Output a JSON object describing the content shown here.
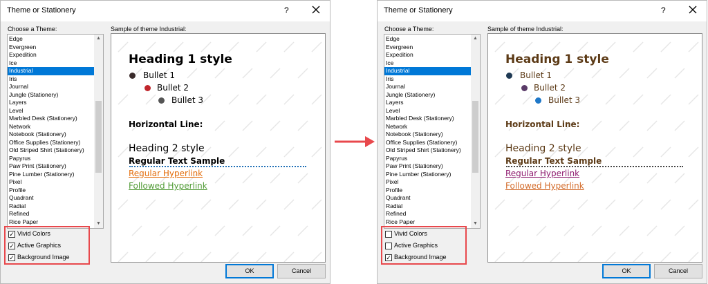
{
  "arrow_color": "#e8484c",
  "dialogs": [
    {
      "title": "Theme or Stationery",
      "help": "?",
      "choose_label": "Choose a Theme:",
      "sample_label": "Sample of theme Industrial:",
      "themes": [
        "Edge",
        "Evergreen",
        "Expedition",
        "Ice",
        "Industrial",
        "Iris",
        "Journal",
        "Jungle (Stationery)",
        "Layers",
        "Level",
        "Marbled Desk (Stationery)",
        "Network",
        "Notebook (Stationery)",
        "Office Supplies (Stationery)",
        "Old Striped Shirt (Stationery)",
        "Papyrus",
        "Paw Print (Stationery)",
        "Pine Lumber (Stationery)",
        "Pixel",
        "Profile",
        "Quadrant",
        "Radial",
        "Refined",
        "Rice Paper"
      ],
      "selected_index": 4,
      "options": [
        {
          "label": "Vivid Colors",
          "checked": true
        },
        {
          "label": "Active Graphics",
          "checked": true
        },
        {
          "label": "Background Image",
          "checked": true
        }
      ],
      "preview": {
        "heading1": "Heading 1 style",
        "bullets": [
          "Bullet 1",
          "Bullet 2",
          "Bullet 3"
        ],
        "horizontal_line": "Horizontal Line:",
        "heading2": "Heading 2 style",
        "regular": "Regular Text Sample",
        "hyperlink": "Regular Hyperlink",
        "followed": "Followed Hyperlink",
        "colors": {
          "heading1": "#000000",
          "bullet_text": "#000000",
          "horizontal_line": "#000000",
          "heading2": "#000000",
          "regular": "#000000",
          "hyperlink": "#e36c0a",
          "followed": "#4f9a34",
          "bullet1": "#3a2b2b",
          "bullet2": "#c0262c",
          "bullet3": "#555555",
          "rule": "#1f6fb6"
        }
      },
      "ok": "OK",
      "cancel": "Cancel"
    },
    {
      "title": "Theme or Stationery",
      "help": "?",
      "choose_label": "Choose a Theme:",
      "sample_label": "Sample of theme Industrial:",
      "themes": [
        "Edge",
        "Evergreen",
        "Expedition",
        "Ice",
        "Industrial",
        "Iris",
        "Journal",
        "Jungle (Stationery)",
        "Layers",
        "Level",
        "Marbled Desk (Stationery)",
        "Network",
        "Notebook (Stationery)",
        "Office Supplies (Stationery)",
        "Old Striped Shirt (Stationery)",
        "Papyrus",
        "Paw Print (Stationery)",
        "Pine Lumber (Stationery)",
        "Pixel",
        "Profile",
        "Quadrant",
        "Radial",
        "Refined",
        "Rice Paper"
      ],
      "selected_index": 4,
      "options": [
        {
          "label": "Vivid Colors",
          "checked": false
        },
        {
          "label": "Active Graphics",
          "checked": false
        },
        {
          "label": "Background Image",
          "checked": true
        }
      ],
      "preview": {
        "heading1": "Heading 1 style",
        "bullets": [
          "Bullet 1",
          "Bullet 2",
          "Bullet 3"
        ],
        "horizontal_line": "Horizontal Line:",
        "heading2": "Heading 2 style",
        "regular": "Regular Text Sample",
        "hyperlink": "Regular Hyperlink",
        "followed": "Followed Hyperlink",
        "colors": {
          "heading1": "#5c3a16",
          "bullet_text": "#5c3a16",
          "horizontal_line": "#5c3a16",
          "heading2": "#5c3a16",
          "regular": "#5c3a16",
          "hyperlink": "#8e1a6e",
          "followed": "#d36b2a",
          "bullet1": "#1f3a54",
          "bullet2": "#5a3b68",
          "bullet3": "#1f78c8",
          "rule": "#444444"
        }
      },
      "ok": "OK",
      "cancel": "Cancel"
    }
  ]
}
